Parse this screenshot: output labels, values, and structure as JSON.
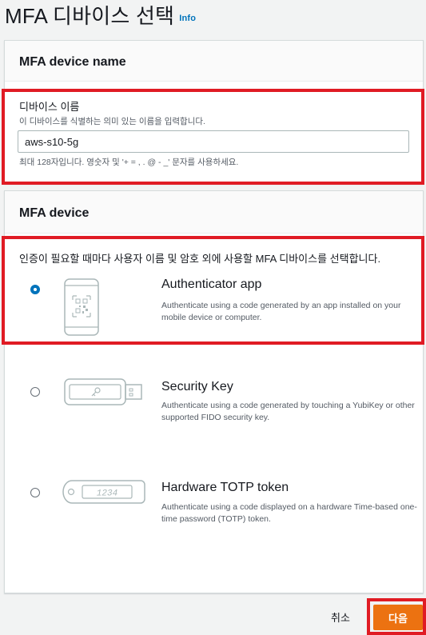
{
  "page": {
    "title": "MFA 디바이스 선택",
    "info_link": "Info"
  },
  "device_name_panel": {
    "header": "MFA device name",
    "field_label": "디바이스 이름",
    "field_description": "이 디바이스를 식별하는 의미 있는 이름을 입력합니다.",
    "field_value": "aws-s10-5g",
    "constraint": "최대 128자입니다. 영숫자 및 '+ = , . @ - _' 문자를 사용하세요."
  },
  "device_panel": {
    "header": "MFA device",
    "instruction": "인증이 필요할 때마다 사용자 이름 및 암호 외에 사용할 MFA 디바이스를 선택합니다.",
    "options": [
      {
        "title": "Authenticator app",
        "description": "Authenticate using a code generated by an app installed on your mobile device or computer.",
        "selected": true,
        "icon": "phone-qr-icon"
      },
      {
        "title": "Security Key",
        "description": "Authenticate using a code generated by touching a YubiKey or other supported FIDO security key.",
        "selected": false,
        "icon": "usb-key-icon"
      },
      {
        "title": "Hardware TOTP token",
        "description": "Authenticate using a code displayed on a hardware Time-based one-time password (TOTP) token.",
        "selected": false,
        "icon": "totp-token-icon",
        "token_display": "1234"
      }
    ]
  },
  "footer": {
    "cancel_label": "취소",
    "next_label": "다음"
  },
  "colors": {
    "accent": "#0073bb",
    "primary_button": "#ec7211",
    "highlight": "#e01b24"
  }
}
